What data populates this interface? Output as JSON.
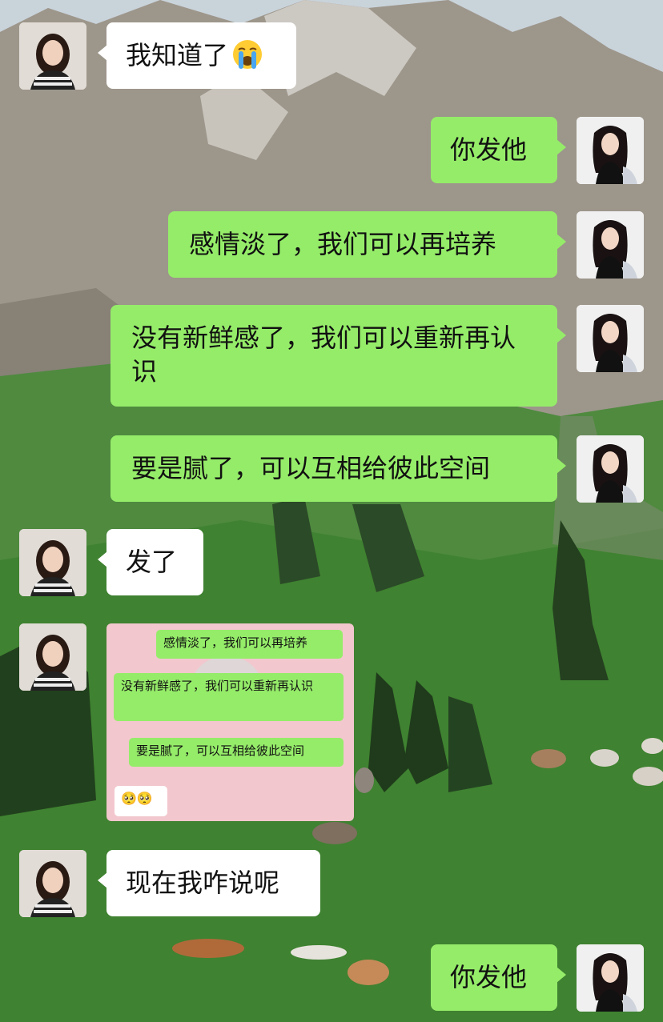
{
  "messages": [
    {
      "side": "left",
      "text": "我知道了",
      "emoji": "loudly-crying-face"
    },
    {
      "side": "right",
      "text": "你发他"
    },
    {
      "side": "right",
      "text": "感情淡了，我们可以再培养"
    },
    {
      "side": "right",
      "text": "没有新鲜感了，我们可以重新再认识"
    },
    {
      "side": "right",
      "text": "要是腻了，可以互相给彼此空间"
    },
    {
      "side": "left",
      "text": "发了"
    },
    {
      "side": "left",
      "type": "image"
    },
    {
      "side": "left",
      "text": "现在我咋说呢"
    },
    {
      "side": "right",
      "text": "你发他"
    }
  ],
  "screenshot": {
    "lines": [
      "感情淡了，我们可以再培养",
      "没有新鲜感了，我们可以重新再认识",
      "要是腻了，可以互相给彼此空间"
    ],
    "emoji_line": "🥺🥺"
  },
  "colors": {
    "green_bubble": "#95ec69",
    "white_bubble": "#ffffff",
    "screenshot_bg": "#f2c7cd"
  }
}
